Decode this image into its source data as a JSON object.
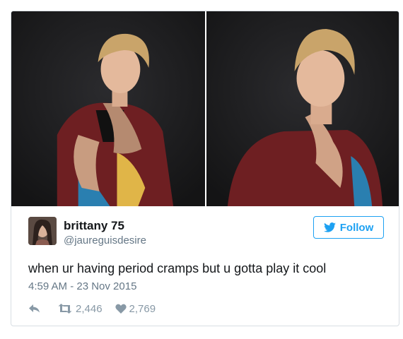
{
  "tweet": {
    "display_name": "brittany 75",
    "handle": "@jaureguisdesire",
    "text": "when ur having period cramps but u gotta play it cool",
    "timestamp": "4:59 AM - 23 Nov 2015",
    "retweet_count": "2,446",
    "like_count": "2,769"
  },
  "follow_button": {
    "label": "Follow"
  },
  "icons": {
    "follow": "twitter-bird-icon",
    "reply": "reply-arrow-icon",
    "retweet": "retweet-icon",
    "like": "heart-icon"
  },
  "colors": {
    "accent": "#1da1f2",
    "muted": "#657786",
    "action_icons": "#8899a6",
    "text": "#14171a",
    "photo_background": "#1c1c1e"
  }
}
